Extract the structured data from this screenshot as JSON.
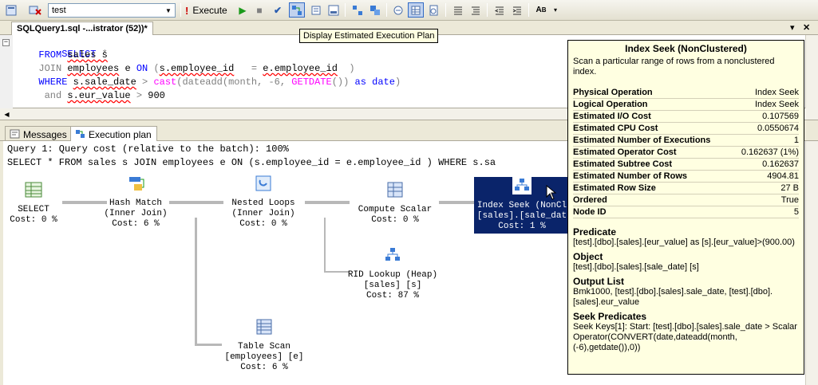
{
  "toolbar": {
    "database": "test",
    "execute_label": "Execute",
    "tooltip": "Display Estimated Execution Plan"
  },
  "document": {
    "tab_title": "SQLQuery1.sql -...istrator (52))*"
  },
  "editor": {
    "kw_select": "SELECT",
    "star": "*",
    "kw_from": "FROM",
    "from_rest": "sales s",
    "kw_join": "JOIN",
    "join_tbl": "employees",
    "join_alias": "e",
    "kw_on": "ON",
    "paren_open": "(",
    "on_left": "s.employee_id",
    "eq": "=",
    "on_right": "e.employee_id",
    "paren_close": ")",
    "kw_where": "WHERE",
    "where_col": "s.sale_date",
    "gt": ">",
    "fn_cast": "cast",
    "fn_dateadd": "(dateadd",
    "args": "(month, -6,",
    "fn_getdate": "GETDATE",
    "getdate_rest": "())",
    "kw_as": "as",
    "kw_date": "date",
    "close": ")",
    "kw_and": "and",
    "and_col": "s.eur_value",
    "and_val": "900"
  },
  "results": {
    "tab_messages": "Messages",
    "tab_plan": "Execution plan"
  },
  "plan": {
    "query_cost": "Query 1: Query cost (relative to the batch): 100%",
    "query_text": "SELECT * FROM sales s JOIN employees e ON (s.employee_id = e.employee_id ) WHERE s.sa",
    "nodes": {
      "select": {
        "l1": "SELECT",
        "l2": "Cost: 0 %"
      },
      "hash": {
        "l1": "Hash Match",
        "l2": "(Inner Join)",
        "l3": "Cost: 6 %"
      },
      "nested": {
        "l1": "Nested Loops",
        "l2": "(Inner Join)",
        "l3": "Cost: 0 %"
      },
      "compute": {
        "l1": "Compute Scalar",
        "l2": "Cost: 0 %"
      },
      "seek": {
        "l1": "Index Seek (NonCl",
        "l2": "[sales].[sale_dat",
        "l3": "Cost: 1 %"
      },
      "rid": {
        "l1": "RID Lookup (Heap)",
        "l2": "[sales] [s]",
        "l3": "Cost: 87 %"
      },
      "scan": {
        "l1": "Table Scan",
        "l2": "[employees] [e]",
        "l3": "Cost: 6 %"
      }
    }
  },
  "details": {
    "title": "Index Seek (NonClustered)",
    "description": "Scan a particular range of rows from a nonclustered index.",
    "props": [
      {
        "k": "Physical Operation",
        "v": "Index Seek"
      },
      {
        "k": "Logical Operation",
        "v": "Index Seek"
      },
      {
        "k": "Estimated I/O Cost",
        "v": "0.107569"
      },
      {
        "k": "Estimated CPU Cost",
        "v": "0.0550674"
      },
      {
        "k": "Estimated Number of Executions",
        "v": "1"
      },
      {
        "k": "Estimated Operator Cost",
        "v": "0.162637 (1%)"
      },
      {
        "k": "Estimated Subtree Cost",
        "v": "0.162637"
      },
      {
        "k": "Estimated Number of Rows",
        "v": "4904.81"
      },
      {
        "k": "Estimated Row Size",
        "v": "27 B"
      },
      {
        "k": "Ordered",
        "v": "True"
      },
      {
        "k": "Node ID",
        "v": "5"
      }
    ],
    "predicate_title": "Predicate",
    "predicate": "[test].[dbo].[sales].[eur_value] as [s].[eur_value]>(900.00)",
    "object_title": "Object",
    "object": "[test].[dbo].[sales].[sale_date] [s]",
    "output_title": "Output List",
    "output": "Bmk1000, [test].[dbo].[sales].sale_date, [test].[dbo].[sales].eur_value",
    "seek_title": "Seek Predicates",
    "seek": "Seek Keys[1]: Start: [test].[dbo].[sales].sale_date > Scalar Operator(CONVERT(date,dateadd(month,(-6),getdate()),0))"
  }
}
